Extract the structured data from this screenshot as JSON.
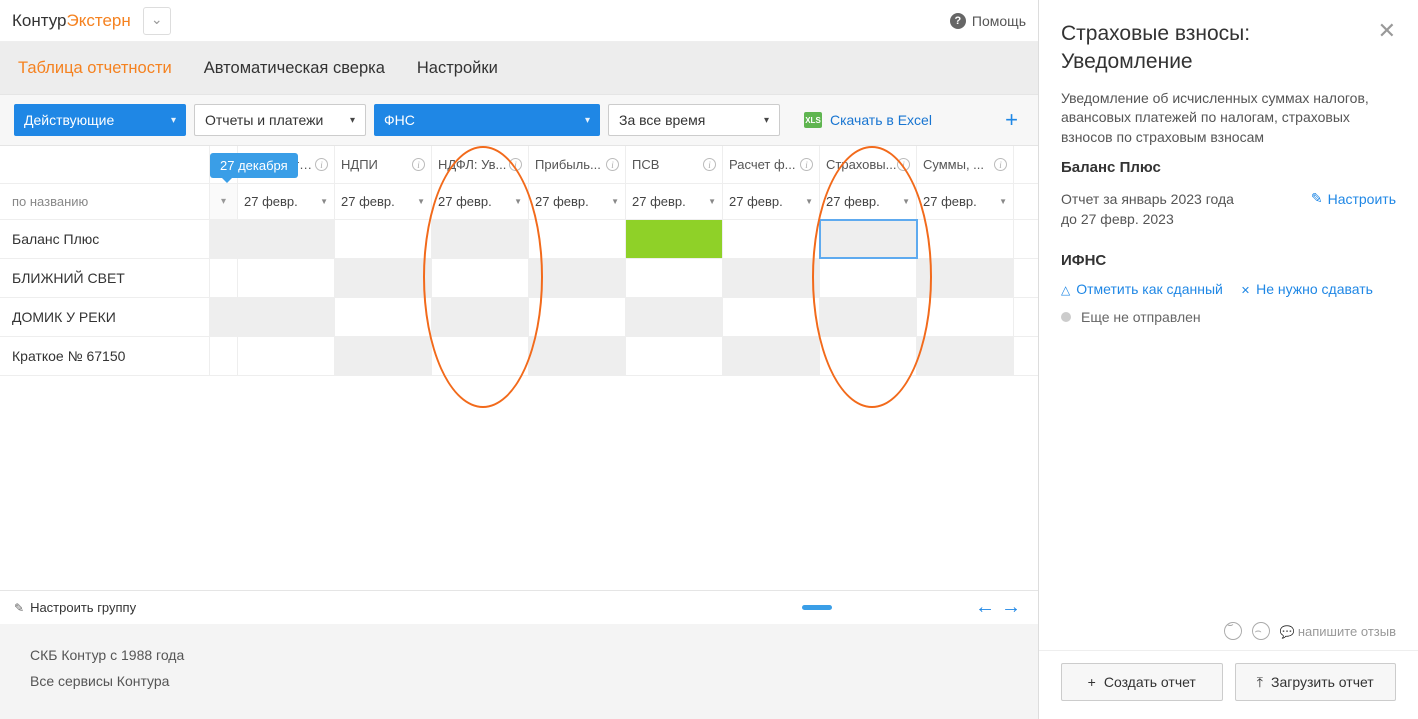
{
  "header": {
    "logo_part1": "Контур",
    "logo_part2": "Экстерн",
    "help": "Помощь"
  },
  "tabs": {
    "reporting": "Таблица отчетности",
    "reconciliation": "Автоматическая сверка",
    "settings": "Настройки"
  },
  "filters": {
    "status": "Действующие",
    "type": "Отчеты и платежи",
    "authority": "ФНС",
    "period": "За все время",
    "excel": "Скачать в Excel"
  },
  "date_badge": "27 декабря",
  "table": {
    "name_header": "по названию",
    "columns": [
      {
        "label": "Имуществ..."
      },
      {
        "label": "НДПИ"
      },
      {
        "label": "НДФЛ: Ув..."
      },
      {
        "label": "Прибыль..."
      },
      {
        "label": "ПСВ"
      },
      {
        "label": "Расчет ф..."
      },
      {
        "label": "Страховы..."
      },
      {
        "label": "Суммы, ..."
      }
    ],
    "date_filter": "27 февр.",
    "rows": [
      {
        "name": "Баланс Плюс"
      },
      {
        "name": "БЛИЖНИЙ СВЕТ"
      },
      {
        "name": "ДОМИК У РЕКИ"
      },
      {
        "name": "Краткое № 67150"
      }
    ]
  },
  "grid_footer": {
    "configure": "Настроить группу"
  },
  "global_footer": {
    "line1": "СКБ Контур с 1988 года",
    "line2": "Все сервисы Контура"
  },
  "sidepanel": {
    "title": "Страховые взносы: Уведомление",
    "desc": "Уведомление об исчисленных суммах налогов, авансовых платежей по налогам, страховых взносов по страховым взносам",
    "company": "Баланс Плюс",
    "period_line1": "Отчет за январь 2023 года",
    "period_line2": "до 27 февр. 2023",
    "configure": "Настроить",
    "section": "ИФНС",
    "mark_done": "Отметить как сданный",
    "no_need": "Не нужно сдавать",
    "status": "Еще не отправлен",
    "feedback": "напишите отзыв",
    "btn_create": "Создать отчет",
    "btn_upload": "Загрузить отчет"
  }
}
